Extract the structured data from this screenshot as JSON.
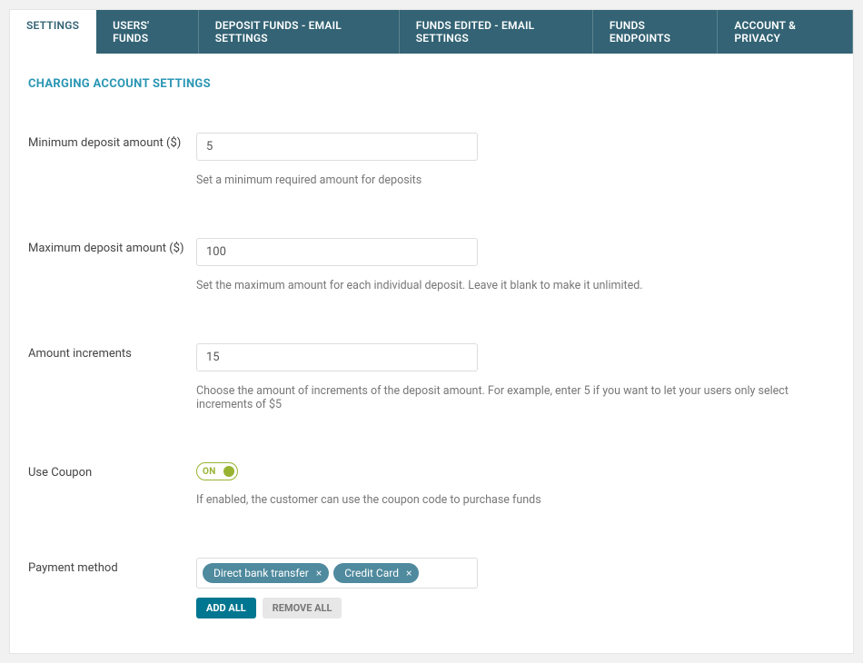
{
  "tabs": [
    {
      "label": "SETTINGS",
      "active": true
    },
    {
      "label": "USERS' FUNDS",
      "active": false
    },
    {
      "label": "DEPOSIT FUNDS - EMAIL SETTINGS",
      "active": false
    },
    {
      "label": "FUNDS EDITED - EMAIL SETTINGS",
      "active": false
    },
    {
      "label": "FUNDS ENDPOINTS",
      "active": false
    },
    {
      "label": "ACCOUNT & PRIVACY",
      "active": false
    }
  ],
  "section_title": "CHARGING ACCOUNT SETTINGS",
  "fields": {
    "min_deposit": {
      "label": "Minimum deposit amount ($)",
      "value": "5",
      "help": "Set a minimum required amount for deposits"
    },
    "max_deposit": {
      "label": "Maximum deposit amount ($)",
      "value": "100",
      "help": "Set the maximum amount for each individual deposit. Leave it blank to make it unlimited."
    },
    "increments": {
      "label": "Amount increments",
      "value": "15",
      "help": "Choose the amount of increments of the deposit amount. For example, enter 5 if you want to let your users only select increments of $5"
    },
    "use_coupon": {
      "label": "Use Coupon",
      "state_text": "ON",
      "help": "If enabled, the customer can use the coupon code to purchase funds"
    },
    "payment_method": {
      "label": "Payment method",
      "selected": [
        {
          "label": "Direct bank transfer"
        },
        {
          "label": "Credit Card"
        }
      ],
      "add_all_label": "ADD ALL",
      "remove_all_label": "REMOVE ALL",
      "tag_close_glyph": "×"
    }
  }
}
